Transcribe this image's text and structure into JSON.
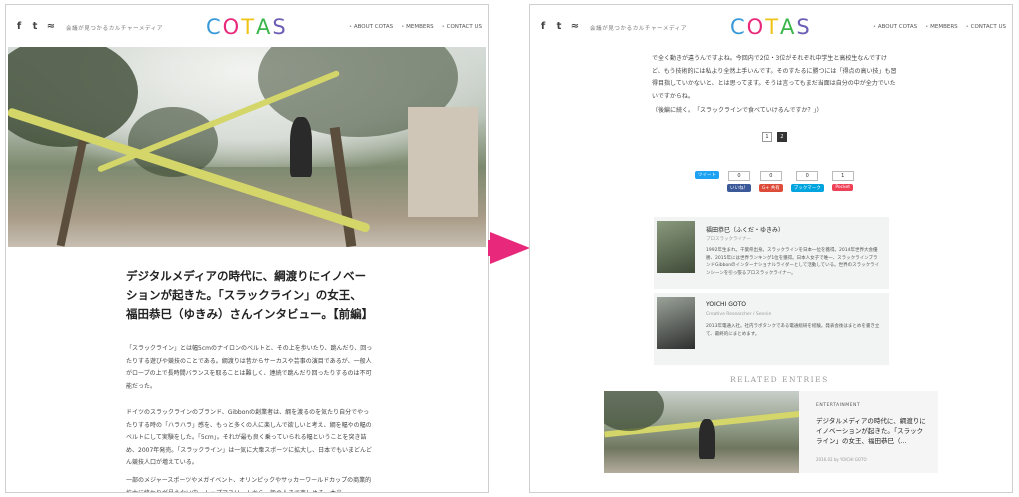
{
  "header": {
    "social_icons": [
      "facebook-icon",
      "twitter-icon",
      "rss-icon"
    ],
    "social_glyphs": [
      "f",
      "t",
      "≈"
    ],
    "tagline": "会議が見つかるカルチャーメディア",
    "logo_letters": [
      "C",
      "O",
      "T",
      "A",
      "S"
    ],
    "logo_colors": [
      "#3a9ad9",
      "#e8287a",
      "#f0c419",
      "#39b54a",
      "#6b5fb5"
    ],
    "nav": [
      "ABOUT COTAS",
      "MEMBERS",
      "CONTACT US"
    ]
  },
  "left": {
    "title": "デジタルメディアの時代に、綱渡りにイノベーションが起きた。「スラックライン」の女王、福田恭巳（ゆきみ）さんインタビュー。【前編】",
    "paragraphs": [
      "「スラックライン」とは幅5cmのナイロンのベルトと、その上を歩いたり、跳んだり、回ったりする遊びや競技のことである。綱渡りは昔からサーカスや芸事の演目であるが、一般人がロープの上で長時間バランスを取ることは難しく、連続で跳んだり回ったりするのは不可能だった。",
      "ドイツのスラックラインのブランド、Gibbonの創業者は、綱を渡るのを気たり自分でやったりする時の「ハラハラ」感を、もっと多くの人に楽しんで欲しいと考え、綱を幅やの幅のベルトにして実験をした。「5cm」。それが最も良く乗っていられる幅ということを突き詰め、2007年発売。「スラックライン」は一気に大衆スポーツに拡大し、日本でもいまどんどん競技人口が増えている。",
      "一部のメジャースポーツやメガイベント、オリンピックやサッカーワールドカップの商業的拡大に終わりが見えない中、トップアスリートから一般の人まで楽しめる、本当"
    ]
  },
  "right": {
    "paragraph": "で全く動きが違うんですよね。今回内で2位・3位がそれぞれ中学生と高校生なんですけど、もう技術的には私より全然上手いんです。そのすたるに勝つには「得点の高い技」も習得目指していかないと、とは思ってます。そうは言ってもまだ当面は自分の中が全力でいたいですからね。",
    "continued": "（後編に続く。　「スラックラインで食べていけるんですか？」）",
    "pages": [
      "1",
      "2"
    ],
    "share": [
      {
        "count": "0",
        "label": "ツイート",
        "color": "#1da1f2"
      },
      {
        "count": "0",
        "label": "いいね！",
        "color": "#3b5998"
      },
      {
        "count": "0",
        "label": "B!",
        "color": "#00a4de"
      },
      {
        "count": "1",
        "label": "Pocket",
        "color": "#ef4056"
      }
    ],
    "share_extra": [
      "G+ 共有",
      "ブックマーク"
    ],
    "authors": [
      {
        "name": "福田恭巳（ふくだ・ゆきみ）",
        "role": "プロスラックライナー",
        "bio": "1992年生まれ。千葉県出身。スラックラインを日本一位を獲得。2014年世界大会優勝、2015年には世界ランキング1位を獲得。日本人女子で唯一、スラックラインブランドGibbonのインターナショナルライダーとして活動している。世界のスラックラインシーンを引っ張るプロスラックライナー。"
      },
      {
        "name": "YOICHI GOTO",
        "role": "Creative Researcher / Sennin",
        "bio": "2013年電通入社。社内ラボタンクである電通総研を経験。発表会後はまとめを書き立て、最終的にまとめます。"
      }
    ],
    "related_heading": "RELATED ENTRIES",
    "related": {
      "category": "ENTERTAINMENT",
      "title": "デジタルメディアの時代に、綱渡りにイノベーションが起きた。「スラックライン」の女王、福田恭巳（...",
      "meta": "2016.02 by YOICHI GOTO"
    }
  }
}
